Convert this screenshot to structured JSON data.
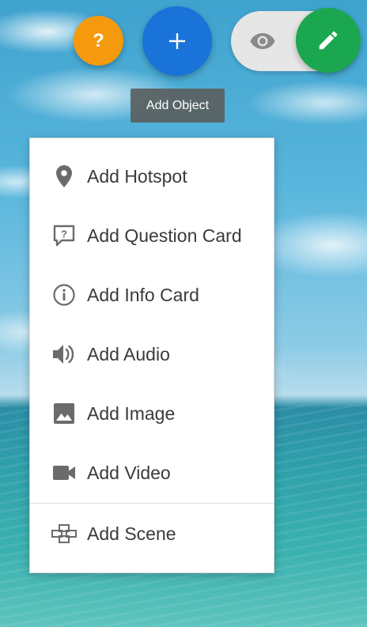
{
  "toolbar": {
    "help_label": "?",
    "add_tooltip": "Add Object"
  },
  "colors": {
    "help": "#f59a0c",
    "add": "#1a73d9",
    "edit": "#1aa750",
    "toggle_bg": "#e6e6e6"
  },
  "menu": {
    "items": [
      {
        "label": "Add Hotspot",
        "icon": "map-pin-icon"
      },
      {
        "label": "Add Question Card",
        "icon": "question-card-icon"
      },
      {
        "label": "Add Info Card",
        "icon": "info-icon"
      },
      {
        "label": "Add Audio",
        "icon": "speaker-icon"
      },
      {
        "label": "Add Image",
        "icon": "image-icon"
      },
      {
        "label": "Add Video",
        "icon": "video-camera-icon"
      },
      {
        "label": "Add Scene",
        "icon": "scene-icon"
      }
    ]
  }
}
